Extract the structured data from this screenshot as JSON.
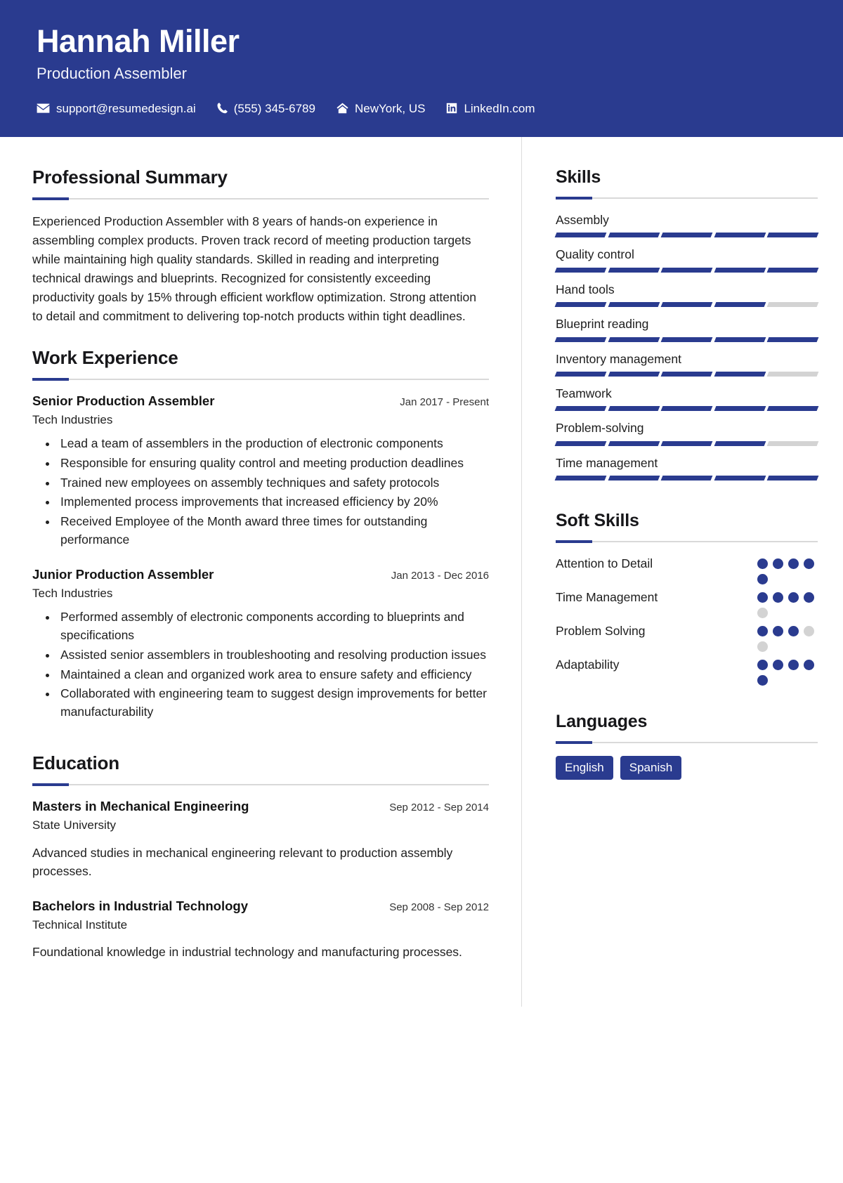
{
  "theme": {
    "accent": "#2a3b8f",
    "muted": "#d3d3d3",
    "rule": "#d9d9d9",
    "text": "#1b1b1b",
    "header_bg": "#2a3b8f",
    "header_text": "#ffffff"
  },
  "header": {
    "name": "Hannah Miller",
    "job_title": "Production Assembler",
    "contacts": [
      {
        "icon": "envelope-icon",
        "text": "support@resumedesign.ai"
      },
      {
        "icon": "phone-icon",
        "text": "(555) 345-6789"
      },
      {
        "icon": "home-icon",
        "text": "NewYork, US"
      },
      {
        "icon": "linkedin-icon",
        "text": "LinkedIn.com"
      }
    ]
  },
  "main": {
    "summary": {
      "title": "Professional Summary",
      "text": "Experienced Production Assembler with 8 years of hands-on experience in assembling complex products. Proven track record of meeting production targets while maintaining high quality standards. Skilled in reading and interpreting technical drawings and blueprints. Recognized for consistently exceeding productivity goals by 15% through efficient workflow optimization. Strong attention to detail and commitment to delivering top-notch products within tight deadlines."
    },
    "experience": {
      "title": "Work Experience",
      "entries": [
        {
          "role": "Senior Production Assembler",
          "date": "Jan 2017 - Present",
          "org": "Tech Industries",
          "bullets": [
            "Lead a team of assemblers in the production of electronic components",
            "Responsible for ensuring quality control and meeting production deadlines",
            "Trained new employees on assembly techniques and safety protocols",
            "Implemented process improvements that increased efficiency by 20%",
            "Received Employee of the Month award three times for outstanding performance"
          ]
        },
        {
          "role": "Junior Production Assembler",
          "date": "Jan 2013 - Dec 2016",
          "org": "Tech Industries",
          "bullets": [
            "Performed assembly of electronic components according to blueprints and specifications",
            "Assisted senior assemblers in troubleshooting and resolving production issues",
            "Maintained a clean and organized work area to ensure safety and efficiency",
            "Collaborated with engineering team to suggest design improvements for better manufacturability"
          ]
        }
      ]
    },
    "education": {
      "title": "Education",
      "entries": [
        {
          "degree": "Masters in Mechanical Engineering",
          "date": "Sep 2012 - Sep 2014",
          "school": "State University",
          "description": "Advanced studies in mechanical engineering relevant to production assembly processes."
        },
        {
          "degree": "Bachelors in Industrial Technology",
          "date": "Sep 2008 - Sep 2012",
          "school": "Technical Institute",
          "description": "Foundational knowledge in industrial technology and manufacturing processes."
        }
      ]
    }
  },
  "sidebar": {
    "skills": {
      "title": "Skills",
      "segments_total": 5,
      "items": [
        {
          "name": "Assembly",
          "filled": 5
        },
        {
          "name": "Quality control",
          "filled": 5
        },
        {
          "name": "Hand tools",
          "filled": 4
        },
        {
          "name": "Blueprint reading",
          "filled": 5
        },
        {
          "name": "Inventory management",
          "filled": 4
        },
        {
          "name": "Teamwork",
          "filled": 5
        },
        {
          "name": "Problem-solving",
          "filled": 4
        },
        {
          "name": "Time management",
          "filled": 5
        }
      ]
    },
    "soft_skills": {
      "title": "Soft Skills",
      "dots_total": 5,
      "items": [
        {
          "name": "Attention to Detail",
          "filled": 5
        },
        {
          "name": "Time Management",
          "filled": 4
        },
        {
          "name": "Problem Solving",
          "filled": 3
        },
        {
          "name": "Adaptability",
          "filled": 5
        }
      ]
    },
    "languages": {
      "title": "Languages",
      "items": [
        "English",
        "Spanish"
      ]
    }
  }
}
